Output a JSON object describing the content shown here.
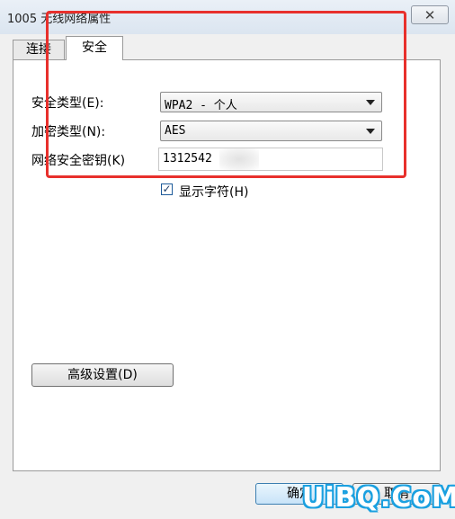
{
  "window": {
    "title": "1005 无线网络属性",
    "close_glyph": "✕"
  },
  "tabs": [
    {
      "label": "连接",
      "selected": false
    },
    {
      "label": "安全",
      "selected": true
    }
  ],
  "security": {
    "type_label": "安全类型(E):",
    "type_value": "WPA2 - 个人",
    "encryption_label": "加密类型(N):",
    "encryption_value": "AES",
    "key_label": "网络安全密钥(K)",
    "key_value": "1312542",
    "show_chars_label": "显示字符(H)",
    "show_chars_checked": true
  },
  "buttons": {
    "advanced": "高级设置(D)",
    "ok": "确定",
    "cancel": "取消"
  },
  "annotation": {
    "color": "#e8302c"
  },
  "watermark": {
    "text": "UiBQ.CoM",
    "color": "#1aa0e0"
  }
}
